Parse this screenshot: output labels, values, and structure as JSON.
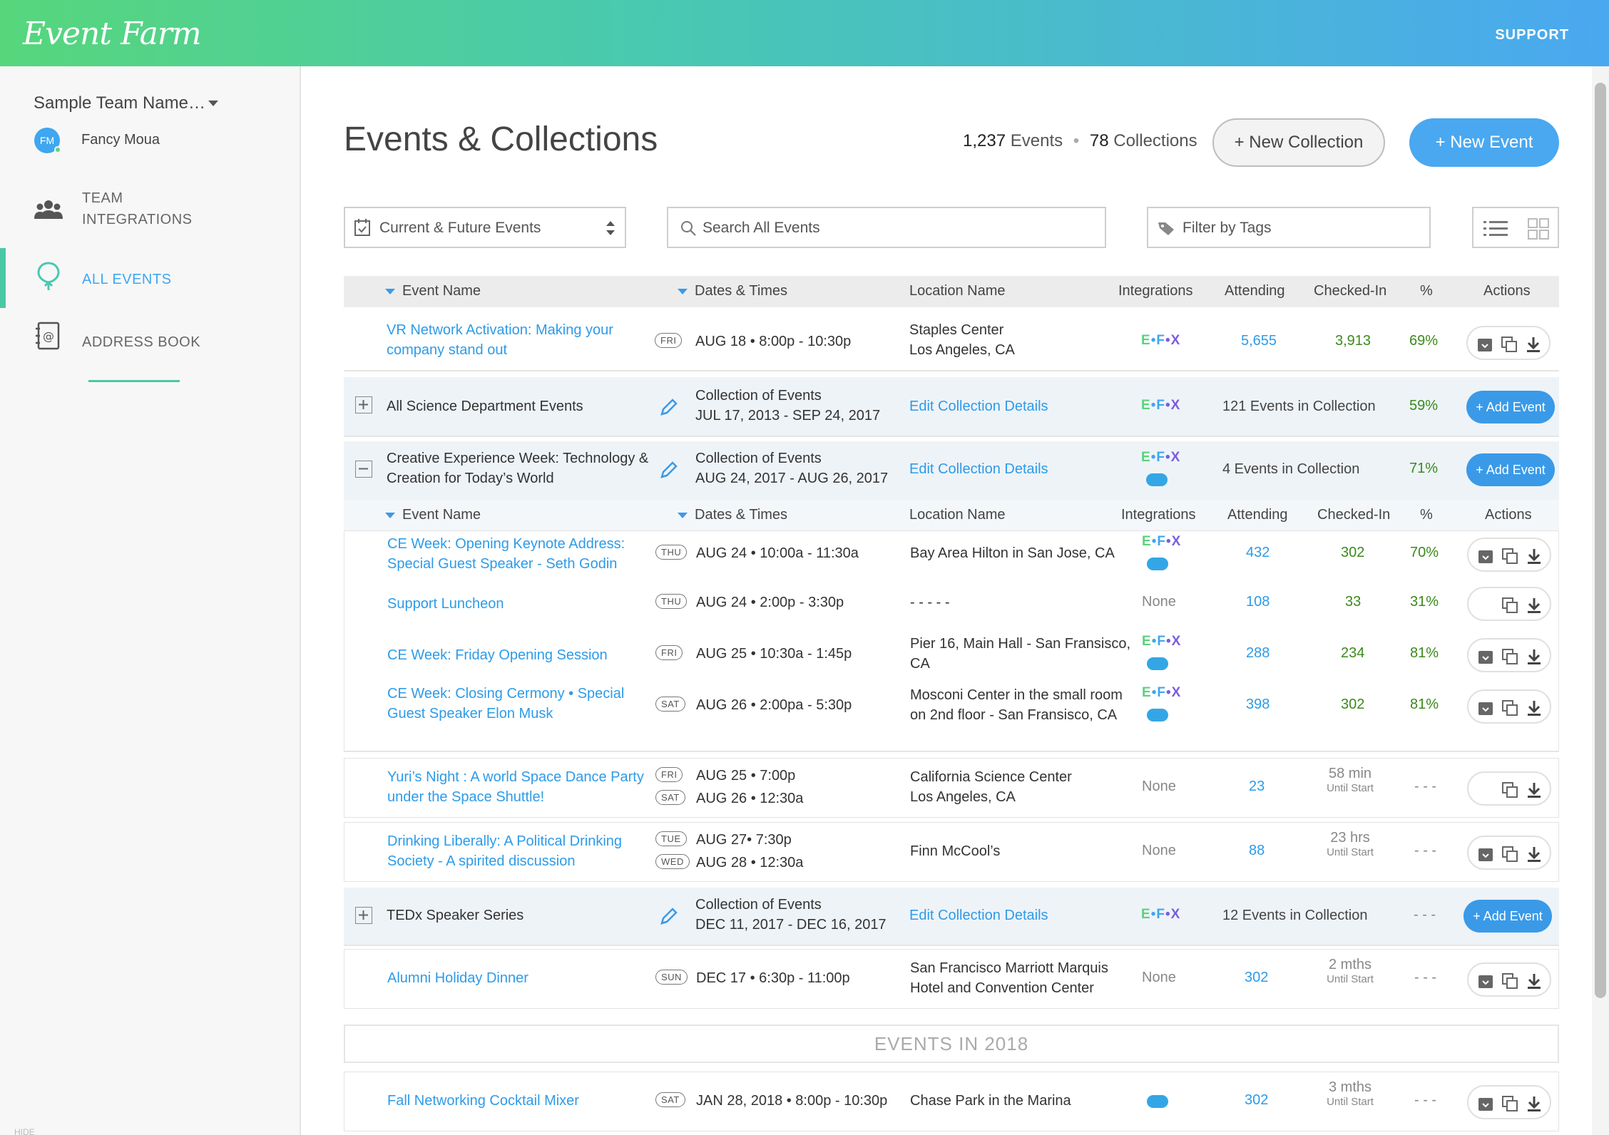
{
  "header": {
    "logo": "Event Farm",
    "support": "SUPPORT"
  },
  "sidebar": {
    "team_name": "Sample Team Name…",
    "user_initials": "FM",
    "user_name": "Fancy Moua",
    "nav": [
      {
        "label_line1": "TEAM",
        "label_line2": "INTEGRATIONS",
        "icon": "team-icon"
      },
      {
        "label": "ALL EVENTS",
        "icon": "balloon-icon",
        "active": true
      },
      {
        "label": "ADDRESS BOOK",
        "icon": "address-book-icon"
      }
    ],
    "hide_label": "HIDE"
  },
  "main": {
    "title": "Events & Collections",
    "events_count": "1,237",
    "events_word": "Events",
    "collections_count": "78",
    "collections_word": "Collections",
    "new_collection": "+ New Collection",
    "new_event": "+ New Event",
    "filter_select": "Current & Future Events",
    "search_placeholder": "Search All Events",
    "tags_placeholder": "Filter by Tags"
  },
  "table": {
    "headers": [
      "Event Name",
      "Dates & Times",
      "Location Name",
      "Integrations",
      "Attending",
      "Checked-In",
      "%",
      "Actions"
    ],
    "rows": [
      {
        "name1": "VR Network Activation: Making your",
        "name2": "company stand out",
        "day": "FRI",
        "date": "AUG 18 • 8:00p - 10:30p",
        "loc1": "Staples Center",
        "loc2": "Los Angeles, CA",
        "attending": "5,655",
        "checked": "3,913",
        "pct": "69%"
      },
      {
        "collection": "All Science Department Events",
        "coll_label": "Collection of Events",
        "coll_range": "JUL 17, 2013 - SEP 24, 2017",
        "edit": "Edit Collection Details",
        "count": "121 Events in Collection",
        "pct": "59%",
        "add": "+ Add Event"
      },
      {
        "collection1": "Creative Experience Week: Technology &",
        "collection2": "Creation for Today’s World",
        "coll_label": "Collection of Events",
        "coll_range": "AUG 24, 2017 - AUG 26, 2017",
        "edit": "Edit Collection Details",
        "count": "4 Events in Collection",
        "pct": "71%",
        "add": "+ Add Event"
      },
      {
        "name1": "CE Week: Opening Keynote Address:",
        "name2": "Special Guest Speaker - Seth Godin",
        "day": "THU",
        "date": "AUG 24 • 10:00a - 11:30a",
        "loc1": "Bay Area Hilton in San Jose, CA",
        "attending": "432",
        "checked": "302",
        "pct": "70%"
      },
      {
        "name1": "Support Luncheon",
        "day": "THU",
        "date": "AUG 24 • 2:00p - 3:30p",
        "loc1": "- - - - -",
        "integ": "None",
        "attending": "108",
        "checked": "33",
        "pct": "31%"
      },
      {
        "name1": "CE Week: Friday Opening Session",
        "day": "FRI",
        "date": "AUG 25 • 10:30a - 1:45p",
        "loc1": "Pier 16, Main Hall - San Fransisco,",
        "loc2": "CA",
        "attending": "288",
        "checked": "234",
        "pct": "81%"
      },
      {
        "name1": "CE Week: Closing Cermony • Special",
        "name2": "Guest Speaker Elon Musk",
        "day": "SAT",
        "date": "AUG 26 • 2:00pa - 5:30p",
        "loc1": "Mosconi Center in the small room",
        "loc2": "on 2nd floor - San Fransisco, CA",
        "attending": "398",
        "checked": "302",
        "pct": "81%"
      },
      {
        "name1": "Yuri’s Night : A world Space Dance Party",
        "name2": "under the Space Shuttle!",
        "day": "FRI",
        "date": "AUG 25 • 7:00p",
        "day2": "SAT",
        "date2": "AUG 26 • 12:30a",
        "loc1": "California Science Center",
        "loc2": "Los Angeles, CA",
        "integ": "None",
        "attending": "23",
        "until1": "58 min",
        "until2": "Until Start",
        "pct": "- - -"
      },
      {
        "name1": "Drinking Liberally: A Political Drinking",
        "name2": "Society - A spirited discussion",
        "day": "TUE",
        "date": "AUG 27• 7:30p",
        "day2": "WED",
        "date2": "AUG 28 • 12:30a",
        "loc1": "Finn McCool’s",
        "integ": "None",
        "attending": "88",
        "until1": "23 hrs",
        "until2": "Until Start",
        "pct": "- - -"
      },
      {
        "collection": "TEDx Speaker Series",
        "coll_label": "Collection of Events",
        "coll_range": "DEC 11, 2017 - DEC 16, 2017",
        "edit": "Edit Collection Details",
        "count": "12 Events in Collection",
        "pct": "- - -",
        "add": "+ Add Event"
      },
      {
        "name1": "Alumni Holiday Dinner",
        "day": "SUN",
        "date": "DEC 17 • 6:30p - 11:00p",
        "loc1": "San Francisco Marriott Marquis",
        "loc2": "Hotel and Convention Center",
        "integ": "None",
        "attending": "302",
        "until1": "2 mths",
        "until2": "Until Start",
        "pct": "- - -"
      },
      {
        "name1": "Fall Networking Cocktail Mixer",
        "day": "SAT",
        "date": "JAN 28, 2018 • 8:00p - 10:30p",
        "loc1": "Chase Park in the Marina",
        "attending": "302",
        "until1": "3 mths",
        "until2": "Until Start",
        "pct": "- - -"
      }
    ],
    "separator_2018": "EVENTS IN 2018",
    "integration_efx": {
      "e": "E",
      "dot1": "•",
      "f": "F",
      "dot2": "•",
      "x": "X"
    }
  },
  "colors": {
    "accent": "#4aa8f0",
    "green": "#5ad27d",
    "link": "#2d9be8"
  }
}
